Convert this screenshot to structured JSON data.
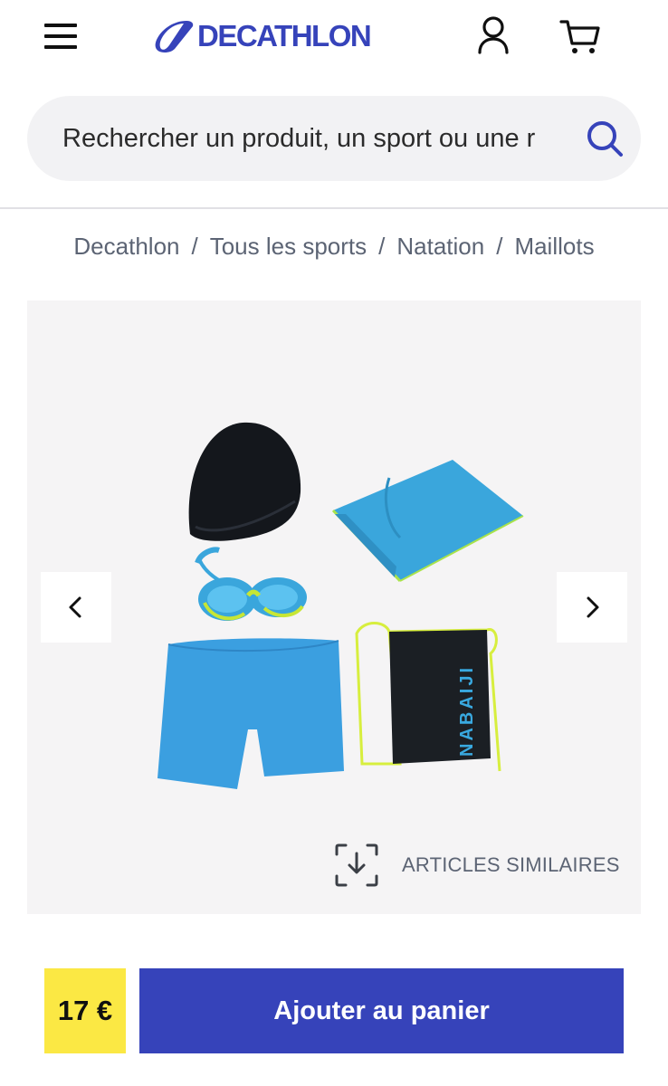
{
  "header": {
    "brand": "DECATHLON",
    "brand_color": "#3643ba",
    "menu_icon": "hamburger-icon",
    "account_icon": "user-icon",
    "cart_icon": "cart-icon"
  },
  "search": {
    "placeholder": "Rechercher un produit, un sport ou une r",
    "value": "",
    "icon": "search-icon"
  },
  "breadcrumb": {
    "items": [
      "Decathlon",
      "Tous les sports",
      "Natation",
      "Maillots"
    ],
    "separator": "/"
  },
  "product_gallery": {
    "image_items": [
      "bonnet",
      "lunettes",
      "serviette",
      "boxer",
      "sac NABAIJI"
    ],
    "bag_print": "NABAIJI",
    "prev_icon": "chevron-left-icon",
    "next_icon": "chevron-right-icon",
    "similar_icon": "visual-search-icon",
    "similar_label": "ARTICLES SIMILAIRES"
  },
  "purchase": {
    "price": "17 €",
    "price_bg": "#fbe844",
    "add_to_cart_label": "Ajouter au panier",
    "button_color": "#3643ba"
  }
}
